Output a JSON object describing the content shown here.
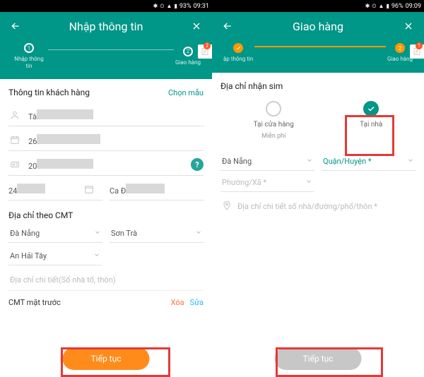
{
  "left": {
    "status": {
      "battery": "93%",
      "time": "09:31"
    },
    "header": {
      "title": "Nhập thông tin",
      "sheet_badge": "2"
    },
    "steps": {
      "s1": "1",
      "s1_label": "Nhập thông tin",
      "s2": "2",
      "s2_label": "Giao hàng"
    },
    "section": {
      "title": "Thông tin khách hàng",
      "choose": "Chọn mẫu"
    },
    "fields": {
      "name_prefix": "Tâ",
      "f2_prefix": "26",
      "f3_prefix": "20",
      "f4_prefix": "24",
      "f5_prefix": "Ca Đ"
    },
    "cmt_section": "Địa chỉ theo CMT",
    "dd": {
      "city": "Đà Nẵng",
      "district": "Sơn Trà",
      "ward": "An Hải Tây"
    },
    "detail_ph": "Địa chỉ chi tiết(Số nhà tổ, thôn)",
    "cmt_front": "CMT mặt trước",
    "xoa": "Xóa",
    "sua": "Sửa",
    "cta": "Tiếp tục"
  },
  "right": {
    "status": {
      "battery": "96%",
      "time": "09:09"
    },
    "header": {
      "title": "Giao hàng",
      "sheet_badge": "1"
    },
    "steps": {
      "s1_label": "ập thông tin",
      "s2_label": "Giao hàng"
    },
    "section": {
      "title": "Địa chỉ nhận sim"
    },
    "opts": {
      "store": "Tại cửa hàng",
      "store_sub": "Miễn phí",
      "home": "Tại nhà"
    },
    "dd": {
      "city": "Đà Nẵng",
      "district": "Quận/Huyện *",
      "ward": "Phường/Xã *"
    },
    "detail_ph": "Địa chỉ chi tiết số nhà/đường/phố/thôn *",
    "cta": "Tiếp tục"
  }
}
